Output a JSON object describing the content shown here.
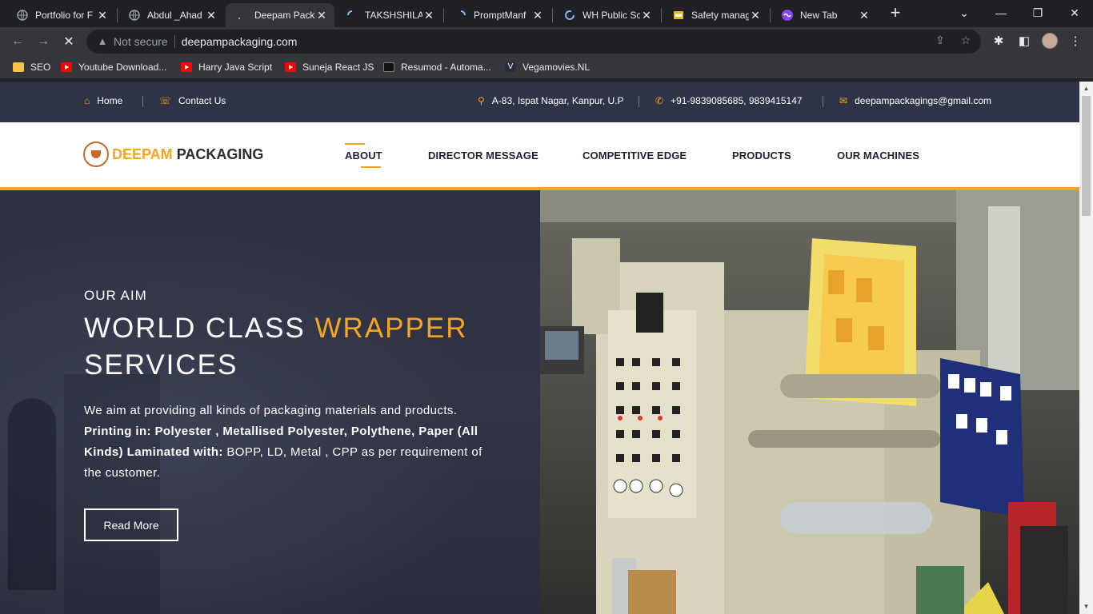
{
  "browser": {
    "tabs": [
      {
        "title": "Portfolio for F",
        "icon": "globe-icon",
        "active": false
      },
      {
        "title": "Abdul _Ahad",
        "icon": "globe-icon",
        "active": false
      },
      {
        "title": "Deepam Pack",
        "icon": "loading-spinner-icon",
        "active": true
      },
      {
        "title": "TAKSHSHILA",
        "icon": "loading-spinner-icon",
        "active": false
      },
      {
        "title": "PromptManf",
        "icon": "loading-spinner-icon",
        "active": false
      },
      {
        "title": "WH Public Sc",
        "icon": "loading-spinner-icon",
        "active": false
      },
      {
        "title": "Safety manag",
        "icon": "slides-icon",
        "active": false
      },
      {
        "title": "New Tab",
        "icon": "newtab-icon",
        "active": false
      }
    ],
    "url_warning": "Not secure",
    "url": "deepampackaging.com",
    "bookmarks": [
      {
        "label": "SEO",
        "icon": "folder-icon"
      },
      {
        "label": "Youtube Download...",
        "icon": "youtube-download-icon"
      },
      {
        "label": "Harry Java Script",
        "icon": "youtube-icon"
      },
      {
        "label": "Suneja React JS",
        "icon": "youtube-icon"
      },
      {
        "label": "Resumod - Automa...",
        "icon": "resumod-icon"
      },
      {
        "label": "Vegamovies.NL",
        "icon": "vegamovies-icon"
      }
    ]
  },
  "topbar": {
    "home": "Home",
    "contact": "Contact Us",
    "address": "A-83, Ispat Nagar, Kanpur, U.P",
    "phone": "+91-9839085685, 9839415147",
    "email": "deepampackagings@gmail.com"
  },
  "nav": {
    "brand_part1": "DEEPAM",
    "brand_part2": "PACKAGING",
    "links": [
      "ABOUT",
      "DIRECTOR MESSAGE",
      "COMPETITIVE EDGE",
      "PRODUCTS",
      "OUR MACHINES"
    ]
  },
  "hero": {
    "eyebrow": "OUR AIM",
    "headline_part1": "WORLD CLASS",
    "headline_highlight": "WRAPPER",
    "headline_part2": "SERVICES",
    "desc_intro": "We aim at providing all kinds of packaging materials and products.",
    "desc_bold1": "Printing in: Polyester , Metallised Polyester, Polythene, Paper (All Kinds) Laminated with:",
    "desc_tail": "BOPP, LD, Metal , CPP as per requirement of the customer.",
    "cta": "Read More",
    "image": "printing-machine-photo"
  },
  "colors": {
    "accent": "#f6a623",
    "topbar_bg": "#2f3347",
    "nav_text": "#1f2133"
  }
}
